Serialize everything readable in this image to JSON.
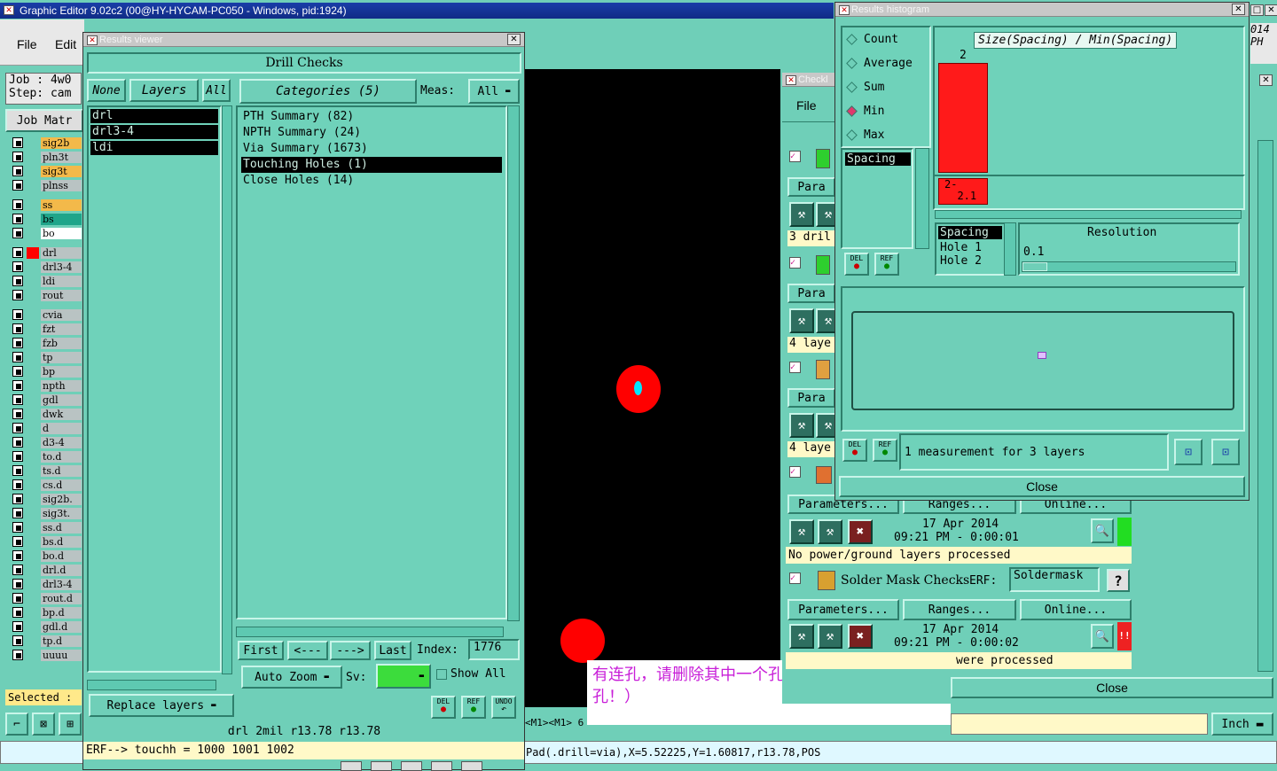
{
  "main_window": {
    "title": "Graphic Editor 9.02c2 (00@HY-HYCAM-PC050 - Windows, pid:1924)",
    "menu": [
      "File",
      "Edit"
    ],
    "job_label": "Job  : 4w0",
    "step_label": "Step: cam",
    "job_matrix_btn": "Job Matr",
    "selected_label": "Selected :",
    "right_edge_text": "014\nPH",
    "units": "Inch",
    "status_coord": "<M1><M1> 6",
    "status_line": "Pad(.drill=via),X=5.52225,Y=1.60817,r13.78,POS"
  },
  "layers": [
    "sig2b",
    "pln3t",
    "sig3t",
    "plnss",
    "ss",
    "bs",
    "bo",
    "drl",
    "drl3-4",
    "ldi",
    "rout",
    "cvia",
    "fzt",
    "fzb",
    "tp",
    "bp",
    "npth",
    "gdl",
    "dwk",
    "d",
    "d3-4",
    "to.d",
    "ts.d",
    "cs.d",
    "sig2b.",
    "sig3t.",
    "ss.d",
    "bs.d",
    "bo.d",
    "drl.d",
    "drl3-4",
    "rout.d",
    "bp.d",
    "gdl.d",
    "tp.d",
    "uuuu"
  ],
  "results_viewer": {
    "title": "Results viewer",
    "header": "Drill Checks",
    "tabs": {
      "none": "None",
      "layers": "Layers",
      "all": "All"
    },
    "layer_list": [
      "drl",
      "drl3-4",
      "ldi"
    ],
    "categories_btn": "Categories (5)",
    "meas_label": "Meas:",
    "meas_value": "All",
    "categories": [
      "PTH Summary (82)",
      "NPTH Summary (24)",
      "Via Summary (1673)",
      "Touching Holes (1)",
      "Close Holes (14)"
    ],
    "nav": {
      "first": "First",
      "prev": "<---",
      "next": "--->",
      "last": "Last",
      "index_label": "Index:",
      "index_value": "1776"
    },
    "auto_zoom": "Auto Zoom",
    "sv_label": "Sv:",
    "show_all": "Show All",
    "replace_layers": "Replace layers",
    "info": "drl  2mil   r13.78   r13.78",
    "erf": "ERF--> touchh  =  1000  1001  1002",
    "del": "DEL",
    "ref": "REF",
    "undo": "UNDO"
  },
  "checklist": {
    "title": "Checkl",
    "file": "File",
    "param": "Para",
    "row1": "3 dril",
    "row2": "4 laye",
    "row3": "4 laye",
    "params_btn": "Parameters...",
    "ranges_btn": "Ranges...",
    "online_btn": "Online...",
    "date1": "17 Apr 2014",
    "time1": "09:21 PM - 0:00:01",
    "msg1": "No power/ground layers processed",
    "solder_title": "Solder Mask Checks",
    "erf_label": "ERF:",
    "erf_value": "Soldermask",
    "help": "?",
    "date2": "17 Apr 2014",
    "time2": "09:21 PM - 0:00:02",
    "msg2": "were processed",
    "close": "Close",
    "status_mark": "!!"
  },
  "histogram": {
    "title": "Results histogram",
    "options": [
      "Count",
      "Average",
      "Sum",
      "Min",
      "Max"
    ],
    "selected_option": "Min",
    "list_item": "Spacing",
    "formula": "Size(Spacing) / Min(Spacing)",
    "bar_label": "2",
    "range_label": "2-\n  2.1",
    "info_items": [
      "Spacing",
      "Hole 1",
      "Hole 2"
    ],
    "resolution_label": "Resolution",
    "resolution_value": "0.1",
    "measurement_text": "1 measurement for 3 layers",
    "close": "Close",
    "bar_count": 1,
    "bar_max": 2
  },
  "annotation": {
    "text": "有连孔，请删除其中一个孔制作（注意更改塞孔！）"
  },
  "colors": {
    "teal": "#6fcfb8",
    "panel": "#5ec9b1",
    "red": "#ff0000",
    "cyan": "#00e5ff",
    "annotation": "#c81ed8",
    "title_blue": "#1a3ea8"
  }
}
